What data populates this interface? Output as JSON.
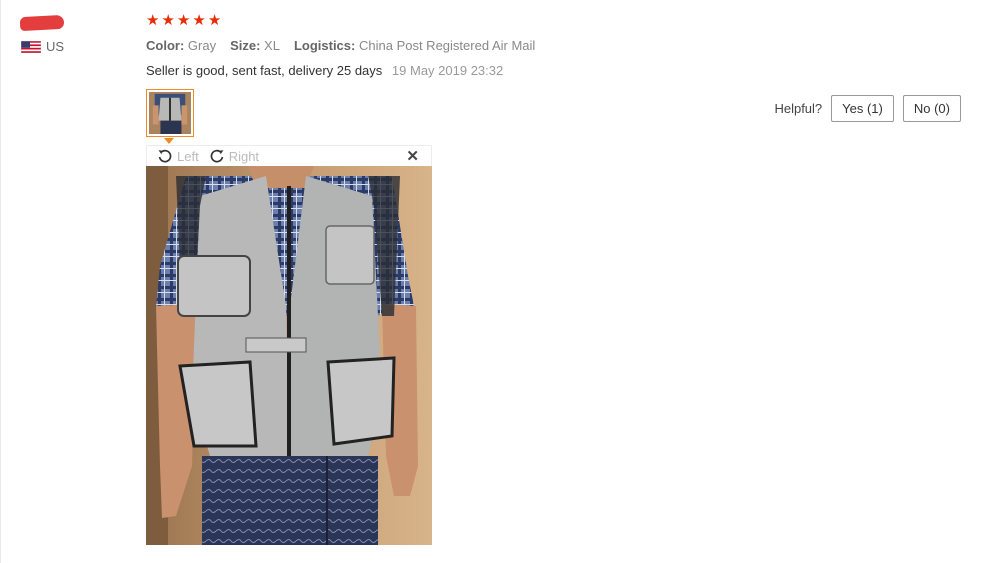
{
  "reviewer": {
    "country": "US"
  },
  "rating": {
    "stars": 5,
    "star_glyph": "★",
    "star_color": "#e62e04"
  },
  "attributes": [
    {
      "key": "Color:",
      "value": "Gray"
    },
    {
      "key": "Size:",
      "value": "XL"
    },
    {
      "key": "Logistics:",
      "value": "China Post Registered Air Mail"
    }
  ],
  "review": {
    "text": "Seller is good, sent fast, delivery 25 days",
    "date": "19 May 2019 23:32"
  },
  "helpful": {
    "label": "Helpful?",
    "yes_label": "Yes (1)",
    "no_label": "No (0)"
  },
  "viewer": {
    "rotate_left_label": "Left",
    "rotate_right_label": "Right",
    "close_glyph": "✕"
  },
  "colors": {
    "accent_orange": "#f08a24",
    "redaction": "#e43d3d"
  },
  "icons": [
    "us-flag-icon",
    "star-icon",
    "rotate-left-icon",
    "rotate-right-icon",
    "close-icon"
  ]
}
